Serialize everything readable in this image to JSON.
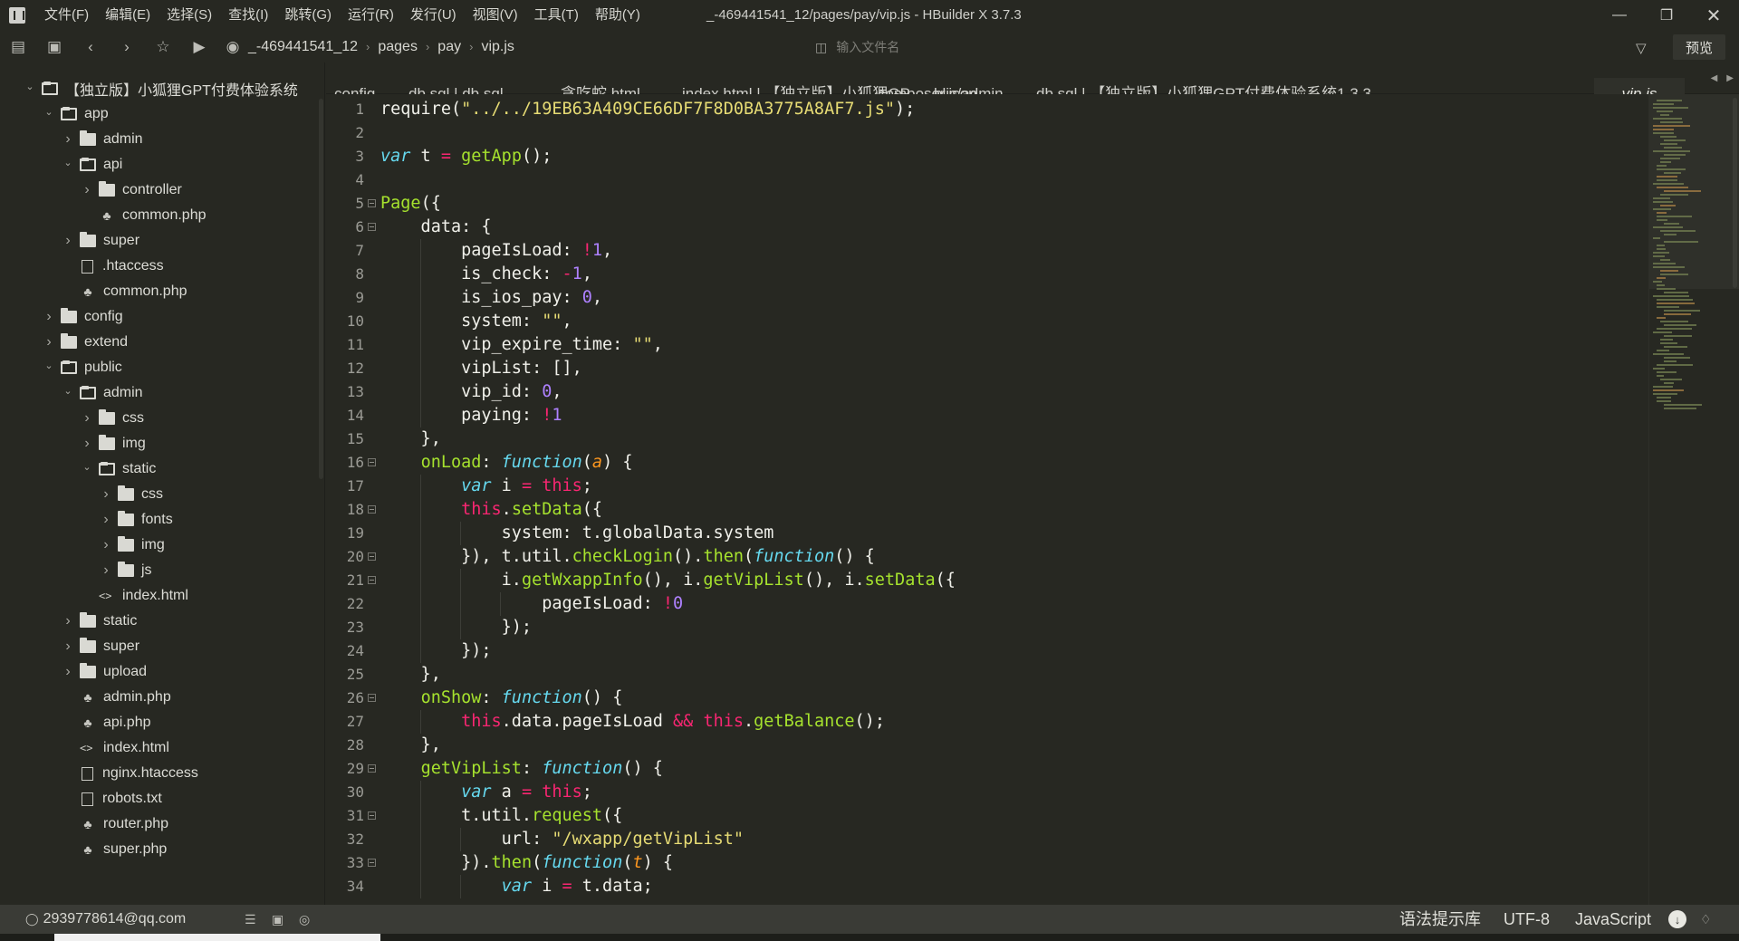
{
  "menu": [
    "文件(F)",
    "编辑(E)",
    "选择(S)",
    "查找(I)",
    "跳转(G)",
    "运行(R)",
    "发行(U)",
    "视图(V)",
    "工具(T)",
    "帮助(Y)"
  ],
  "window_title": "_-469441541_12/pages/pay/vip.js - HBuilder X 3.7.3",
  "breadcrumb": [
    "_-469441541_12",
    "pages",
    "pay",
    "vip.js"
  ],
  "file_search": {
    "placeholder": "输入文件名"
  },
  "preview_label": "预览",
  "tree": [
    {
      "label": "【独立版】小狐狸GPT付费体验系统",
      "depth": 0,
      "kind": "folder-open",
      "chev": "v"
    },
    {
      "label": "app",
      "depth": 1,
      "kind": "folder-open",
      "chev": "v"
    },
    {
      "label": "admin",
      "depth": 2,
      "kind": "folder",
      "chev": ">"
    },
    {
      "label": "api",
      "depth": 2,
      "kind": "folder-open",
      "chev": "v"
    },
    {
      "label": "controller",
      "depth": 3,
      "kind": "folder",
      "chev": ">"
    },
    {
      "label": "common.php",
      "depth": 3,
      "kind": "php",
      "chev": ""
    },
    {
      "label": "super",
      "depth": 2,
      "kind": "folder",
      "chev": ">"
    },
    {
      "label": ".htaccess",
      "depth": 2,
      "kind": "file",
      "chev": ""
    },
    {
      "label": "common.php",
      "depth": 2,
      "kind": "php",
      "chev": ""
    },
    {
      "label": "config",
      "depth": 1,
      "kind": "folder",
      "chev": ">"
    },
    {
      "label": "extend",
      "depth": 1,
      "kind": "folder",
      "chev": ">"
    },
    {
      "label": "public",
      "depth": 1,
      "kind": "folder-open",
      "chev": "v"
    },
    {
      "label": "admin",
      "depth": 2,
      "kind": "folder-open",
      "chev": "v"
    },
    {
      "label": "css",
      "depth": 3,
      "kind": "folder",
      "chev": ">"
    },
    {
      "label": "img",
      "depth": 3,
      "kind": "folder",
      "chev": ">"
    },
    {
      "label": "static",
      "depth": 3,
      "kind": "folder-open",
      "chev": "v"
    },
    {
      "label": "css",
      "depth": 4,
      "kind": "folder",
      "chev": ">"
    },
    {
      "label": "fonts",
      "depth": 4,
      "kind": "folder",
      "chev": ">"
    },
    {
      "label": "img",
      "depth": 4,
      "kind": "folder",
      "chev": ">"
    },
    {
      "label": "js",
      "depth": 4,
      "kind": "folder",
      "chev": ">"
    },
    {
      "label": "index.html",
      "depth": 3,
      "kind": "html",
      "chev": ""
    },
    {
      "label": "static",
      "depth": 2,
      "kind": "folder",
      "chev": ">"
    },
    {
      "label": "super",
      "depth": 2,
      "kind": "folder",
      "chev": ">"
    },
    {
      "label": "upload",
      "depth": 2,
      "kind": "folder",
      "chev": ">"
    },
    {
      "label": "admin.php",
      "depth": 2,
      "kind": "php",
      "chev": ""
    },
    {
      "label": "api.php",
      "depth": 2,
      "kind": "php",
      "chev": ""
    },
    {
      "label": "index.html",
      "depth": 2,
      "kind": "html",
      "chev": ""
    },
    {
      "label": "nginx.htaccess",
      "depth": 2,
      "kind": "file",
      "chev": ""
    },
    {
      "label": "robots.txt",
      "depth": 2,
      "kind": "file",
      "chev": ""
    },
    {
      "label": "router.php",
      "depth": 2,
      "kind": "php",
      "chev": ""
    },
    {
      "label": "super.php",
      "depth": 2,
      "kind": "php",
      "chev": ""
    }
  ],
  "tabs": [
    "config",
    "db.sql | db.sql",
    "贪吃蛇.html",
    "index.html | 【独立版】小狐狸GP......blic/admin",
    "composer.json",
    "db.sql | 【独立版】小狐狸GPT付费体验系统1.3.3",
    "vip.js"
  ],
  "active_tab": "vip.js",
  "code_lines": [
    {
      "n": "1",
      "fold": false,
      "indent": 0,
      "tokens": [
        [
          "t",
          "require("
        ],
        [
          "s",
          "\"../../19EB63A409CE66DF7F8D0BA3775A8AF7.js\""
        ],
        [
          "t",
          ");"
        ]
      ]
    },
    {
      "n": "2",
      "fold": false,
      "indent": 0,
      "tokens": []
    },
    {
      "n": "3",
      "fold": false,
      "indent": 0,
      "tokens": [
        [
          "k",
          "var"
        ],
        [
          "t",
          " t "
        ],
        [
          "o",
          "="
        ],
        [
          "t",
          " "
        ],
        [
          "f",
          "getApp"
        ],
        [
          "t",
          "();"
        ]
      ]
    },
    {
      "n": "4",
      "fold": false,
      "indent": 0,
      "tokens": []
    },
    {
      "n": "5",
      "fold": true,
      "indent": 0,
      "tokens": [
        [
          "f",
          "Page"
        ],
        [
          "t",
          "({"
        ]
      ]
    },
    {
      "n": "6",
      "fold": true,
      "indent": 1,
      "tokens": [
        [
          "t",
          "    data: {"
        ]
      ]
    },
    {
      "n": "7",
      "fold": false,
      "indent": 2,
      "tokens": [
        [
          "t",
          "        pageIsLoad: "
        ],
        [
          "o",
          "!"
        ],
        [
          "n",
          "1"
        ],
        [
          "t",
          ","
        ]
      ]
    },
    {
      "n": "8",
      "fold": false,
      "indent": 2,
      "tokens": [
        [
          "t",
          "        is_check: "
        ],
        [
          "o",
          "-"
        ],
        [
          "n",
          "1"
        ],
        [
          "t",
          ","
        ]
      ]
    },
    {
      "n": "9",
      "fold": false,
      "indent": 2,
      "tokens": [
        [
          "t",
          "        is_ios_pay: "
        ],
        [
          "n",
          "0"
        ],
        [
          "t",
          ","
        ]
      ]
    },
    {
      "n": "10",
      "fold": false,
      "indent": 2,
      "tokens": [
        [
          "t",
          "        system: "
        ],
        [
          "s",
          "\"\""
        ],
        [
          "t",
          ","
        ]
      ]
    },
    {
      "n": "11",
      "fold": false,
      "indent": 2,
      "tokens": [
        [
          "t",
          "        vip_expire_time: "
        ],
        [
          "s",
          "\"\""
        ],
        [
          "t",
          ","
        ]
      ]
    },
    {
      "n": "12",
      "fold": false,
      "indent": 2,
      "tokens": [
        [
          "t",
          "        vipList: [],"
        ]
      ]
    },
    {
      "n": "13",
      "fold": false,
      "indent": 2,
      "tokens": [
        [
          "t",
          "        vip_id: "
        ],
        [
          "n",
          "0"
        ],
        [
          "t",
          ","
        ]
      ]
    },
    {
      "n": "14",
      "fold": false,
      "indent": 2,
      "tokens": [
        [
          "t",
          "        paying: "
        ],
        [
          "o",
          "!"
        ],
        [
          "n",
          "1"
        ]
      ]
    },
    {
      "n": "15",
      "fold": false,
      "indent": 1,
      "tokens": [
        [
          "t",
          "    },"
        ]
      ]
    },
    {
      "n": "16",
      "fold": true,
      "indent": 1,
      "tokens": [
        [
          "t",
          "    "
        ],
        [
          "prop",
          "onLoad"
        ],
        [
          "t",
          ": "
        ],
        [
          "k",
          "function"
        ],
        [
          "t",
          "("
        ],
        [
          "p",
          "a"
        ],
        [
          "t",
          ") {"
        ]
      ]
    },
    {
      "n": "17",
      "fold": false,
      "indent": 2,
      "tokens": [
        [
          "t",
          "        "
        ],
        [
          "k",
          "var"
        ],
        [
          "t",
          " i "
        ],
        [
          "o",
          "="
        ],
        [
          "t",
          " "
        ],
        [
          "th",
          "this"
        ],
        [
          "t",
          ";"
        ]
      ]
    },
    {
      "n": "18",
      "fold": true,
      "indent": 2,
      "tokens": [
        [
          "t",
          "        "
        ],
        [
          "th",
          "this"
        ],
        [
          "t",
          "."
        ],
        [
          "f",
          "setData"
        ],
        [
          "t",
          "({"
        ]
      ]
    },
    {
      "n": "19",
      "fold": false,
      "indent": 3,
      "tokens": [
        [
          "t",
          "            system: t.globalData.system"
        ]
      ]
    },
    {
      "n": "20",
      "fold": true,
      "indent": 2,
      "tokens": [
        [
          "t",
          "        }), t.util."
        ],
        [
          "f",
          "checkLogin"
        ],
        [
          "t",
          "()."
        ],
        [
          "f",
          "then"
        ],
        [
          "t",
          "("
        ],
        [
          "k",
          "function"
        ],
        [
          "t",
          "() {"
        ]
      ]
    },
    {
      "n": "21",
      "fold": true,
      "indent": 3,
      "tokens": [
        [
          "t",
          "            i."
        ],
        [
          "f",
          "getWxappInfo"
        ],
        [
          "t",
          "(), i."
        ],
        [
          "f",
          "getVipList"
        ],
        [
          "t",
          "(), i."
        ],
        [
          "f",
          "setData"
        ],
        [
          "t",
          "({"
        ]
      ]
    },
    {
      "n": "22",
      "fold": false,
      "indent": 4,
      "tokens": [
        [
          "t",
          "                pageIsLoad: "
        ],
        [
          "o",
          "!"
        ],
        [
          "n",
          "0"
        ]
      ]
    },
    {
      "n": "23",
      "fold": false,
      "indent": 3,
      "tokens": [
        [
          "t",
          "            });"
        ]
      ]
    },
    {
      "n": "24",
      "fold": false,
      "indent": 2,
      "tokens": [
        [
          "t",
          "        });"
        ]
      ]
    },
    {
      "n": "25",
      "fold": false,
      "indent": 1,
      "tokens": [
        [
          "t",
          "    },"
        ]
      ]
    },
    {
      "n": "26",
      "fold": true,
      "indent": 1,
      "tokens": [
        [
          "t",
          "    "
        ],
        [
          "prop",
          "onShow"
        ],
        [
          "t",
          ": "
        ],
        [
          "k",
          "function"
        ],
        [
          "t",
          "() {"
        ]
      ]
    },
    {
      "n": "27",
      "fold": false,
      "indent": 2,
      "tokens": [
        [
          "t",
          "        "
        ],
        [
          "th",
          "this"
        ],
        [
          "t",
          ".data.pageIsLoad "
        ],
        [
          "o",
          "&&"
        ],
        [
          "t",
          " "
        ],
        [
          "th",
          "this"
        ],
        [
          "t",
          "."
        ],
        [
          "f",
          "getBalance"
        ],
        [
          "t",
          "();"
        ]
      ]
    },
    {
      "n": "28",
      "fold": false,
      "indent": 1,
      "tokens": [
        [
          "t",
          "    },"
        ]
      ]
    },
    {
      "n": "29",
      "fold": true,
      "indent": 1,
      "tokens": [
        [
          "t",
          "    "
        ],
        [
          "prop",
          "getVipList"
        ],
        [
          "t",
          ": "
        ],
        [
          "k",
          "function"
        ],
        [
          "t",
          "() {"
        ]
      ]
    },
    {
      "n": "30",
      "fold": false,
      "indent": 2,
      "tokens": [
        [
          "t",
          "        "
        ],
        [
          "k",
          "var"
        ],
        [
          "t",
          " a "
        ],
        [
          "o",
          "="
        ],
        [
          "t",
          " "
        ],
        [
          "th",
          "this"
        ],
        [
          "t",
          ";"
        ]
      ]
    },
    {
      "n": "31",
      "fold": true,
      "indent": 2,
      "tokens": [
        [
          "t",
          "        t.util."
        ],
        [
          "f",
          "request"
        ],
        [
          "t",
          "({"
        ]
      ]
    },
    {
      "n": "32",
      "fold": false,
      "indent": 3,
      "tokens": [
        [
          "t",
          "            url: "
        ],
        [
          "s",
          "\"/wxapp/getVipList\""
        ]
      ]
    },
    {
      "n": "33",
      "fold": true,
      "indent": 2,
      "tokens": [
        [
          "t",
          "        })."
        ],
        [
          "f",
          "then"
        ],
        [
          "t",
          "("
        ],
        [
          "k",
          "function"
        ],
        [
          "t",
          "("
        ],
        [
          "p",
          "t"
        ],
        [
          "t",
          ") {"
        ]
      ]
    },
    {
      "n": "34",
      "fold": false,
      "indent": 3,
      "tokens": [
        [
          "t",
          "            "
        ],
        [
          "k",
          "var"
        ],
        [
          "t",
          " i "
        ],
        [
          "o",
          "="
        ],
        [
          "t",
          " t.data;"
        ]
      ]
    }
  ],
  "status": {
    "user_email": "2939778614@qq.com",
    "syntax_lib": "语法提示库",
    "encoding": "UTF-8",
    "language": "JavaScript"
  },
  "icons": {
    "logo": "hbuilder-logo-icon",
    "minimize": "minimize-icon",
    "maximize": "restore-icon",
    "close": "close-icon"
  }
}
